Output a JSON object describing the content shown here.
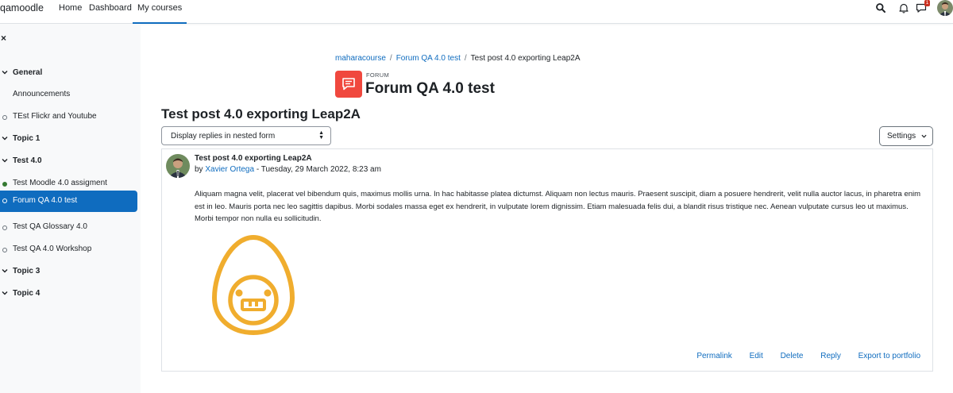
{
  "navbar": {
    "brand": "qamoodle",
    "links": [
      "Home",
      "Dashboard",
      "My courses"
    ],
    "active_link": "My courses",
    "notification_badge": "1",
    "icons": [
      "search-icon",
      "bell-icon",
      "chat-icon",
      "user-avatar"
    ]
  },
  "drawer": {
    "close_glyph": "×",
    "items": [
      {
        "label": "General",
        "kind": "section"
      },
      {
        "label": "Announcements",
        "kind": "plain"
      },
      {
        "label": "TEst Flickr and Youtube",
        "kind": "activity",
        "done": false
      },
      {
        "label": "Topic 1",
        "kind": "section"
      },
      {
        "label": "Test 4.0",
        "kind": "section"
      },
      {
        "label": "Test Moodle 4.0 assigment",
        "kind": "activity",
        "done": true
      },
      {
        "label": "Forum QA 4.0 test",
        "kind": "activity",
        "done": false,
        "active": true
      },
      {
        "label": "Test QA Glossary 4.0",
        "kind": "activity",
        "done": false
      },
      {
        "label": "Test QA 4.0 Workshop",
        "kind": "activity",
        "done": false
      },
      {
        "label": "Topic 3",
        "kind": "section"
      },
      {
        "label": "Topic 4",
        "kind": "section"
      }
    ]
  },
  "breadcrumb": [
    "maharacourse",
    "Forum QA 4.0 test",
    "Test post 4.0 exporting Leap2A"
  ],
  "header": {
    "kicker": "FORUM",
    "title": "Forum QA 4.0 test"
  },
  "discussion": {
    "title": "Test post 4.0 exporting Leap2A",
    "display_mode": "Display replies in nested form",
    "settings_label": "Settings"
  },
  "post": {
    "subject": "Test post 4.0 exporting Leap2A",
    "by_prefix": "by",
    "author": "Xavier Ortega",
    "date": " - Tuesday, 29 March 2022, 8:23 am",
    "body": "Aliquam magna velit, placerat vel bibendum quis, maximus mollis urna. In hac habitasse platea dictumst. Aliquam non lectus mauris. Praesent suscipit, diam a posuere hendrerit, velit nulla auctor lacus, in pharetra enim est in leo. Mauris porta nec leo sagittis dapibus. Morbi sodales massa eget ex hendrerit, in vulputate lorem dignissim. Etiam malesuada felis dui, a blandit risus tristique nec. Aenean vulputate cursus leo ut maximus. Morbi tempor non nulla eu sollicitudin.",
    "actions": [
      "Permalink",
      "Edit",
      "Delete",
      "Reply",
      "Export to portfolio"
    ]
  },
  "colors": {
    "accent": "#0f6cbf",
    "forum_icon_bg": "#f0483e",
    "completion_done": "#357a32",
    "image_stroke": "#f0ad2e"
  }
}
